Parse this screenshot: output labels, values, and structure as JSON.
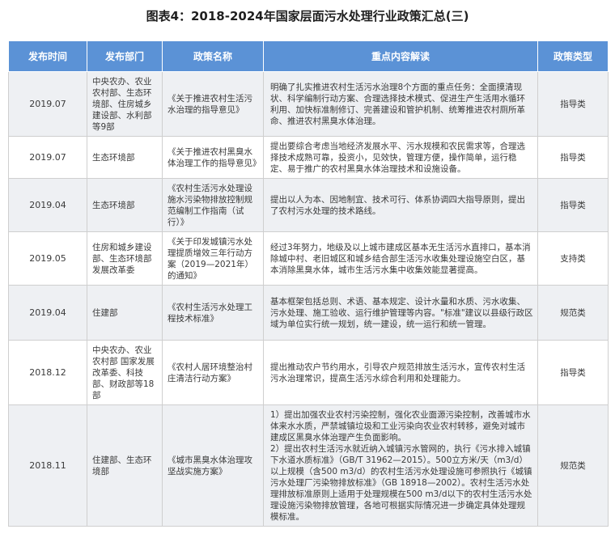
{
  "title": "图表4：2018-2024年国家层面污水处理行业政策汇总(三)",
  "headers": [
    "发布时间",
    "发布部门",
    "政策名称",
    "重点内容解读",
    "政策类型"
  ],
  "rows": [
    {
      "time": "2019.07",
      "dept": "中央农办、农业农村部、生态环境部、住房城乡建设部、水利部等9部",
      "policy": "《关于推进农村生活污水治理的指导意见》",
      "content": "明确了扎实推进农村生活污水治理8个方面的重点任务：全面摸清现状、科学编制行动方案、合理选择技术模式、促进生产生活用水循环利用、加快标准制修订、完善建设和管护机制、统筹推进农村厕所革命、推进农村黑臭水体治理。",
      "type": "指导类"
    },
    {
      "time": "2019.07",
      "dept": "生态环境部",
      "policy": "《关于推进农村黑臭水体治理工作的指导意见》",
      "content": "提出要综合考虑当地经济发展水平、污水规模和农民需求等，合理选择技术成熟可靠，投资小，见效快，管理方便，操作简单，运行稳定、易于推广的农村黑臭水体治理技术和设施设备。",
      "type": "指导类"
    },
    {
      "time": "2019.04",
      "dept": "生态环境部",
      "policy": "《农村生活污水处理设施水污染物排放控制规范编制工作指南（试行）》",
      "content": "提出以人为本、因地制宜、技术可行、体系协调四大指导原则，提出了农村污水处理的技术路线。",
      "type": "指导类"
    },
    {
      "time": "2019.05",
      "dept": "住房和城乡建设部、生态环境部 发展改革委",
      "policy": "《关于印发城镇污水处理提质增效三年行动方案（2019—2021年）的通知》",
      "content": "经过3年努力，地级及以上城市建成区基本无生活污水直排口，基本消除城中村、老旧城区和城乡结合部生活污水收集处理设施空白区，基本消除黑臭水体，城市生活污水集中收集效能显著提高。",
      "type": "支持类"
    },
    {
      "time": "2019.04",
      "dept": "住建部",
      "policy": "《农村生活污水处理工程技术标准》",
      "content": "基本框架包括总则、术语、基本规定、设计水量和水质、污水收集、污水处理、施工验收、运行维护管理等内容。\"标准\"建议以县级行政区域为单位实行统一规划，统一建设，统一运行和统一管理。",
      "type": "规范类"
    },
    {
      "time": "2018.12",
      "dept": "中央农办、农业农村部 国家发展改革委、科技部、财政部等18部",
      "policy": "《农村人居环境整治村庄清洁行动方案》",
      "content": "提出推动农户节约用水，引导农户规范排放生活污水，宣传农村生活污水治理常识，提高生活污水综合利用和处理能力。",
      "type": "指导类"
    },
    {
      "time": "2018.11",
      "dept": "住建部、生态环境部",
      "policy": "《城市黑臭水体治理攻坚战实施方案》",
      "content_lines": [
        "1）提出加强农业农村污染控制，强化农业面源污染控制，改善城市水体来水水质，严禁城镇垃圾和工业污染向农业农村转移，避免对城市建成区黑臭水体治理产生负面影响。",
        "2）提出农村生活污水就近纳入城镇污水管网的，执行《污水排入城镇下水道水质标准》（GB/T 31962—2015）。500立方米/天（m3/d）以上规模（含500 m3/d）的农村生活污水处理设施可参照执行《城镇污水处理厂污染物排放标准》（GB 18918—2002）。农村生活污水处理排放标准原则上适用于处理规模在500 m3/d以下的农村生活污水处理设施污染物排放管理，各地可根据实际情况进一步确定具体处理规模标准。"
      ],
      "type": "规范类"
    }
  ]
}
